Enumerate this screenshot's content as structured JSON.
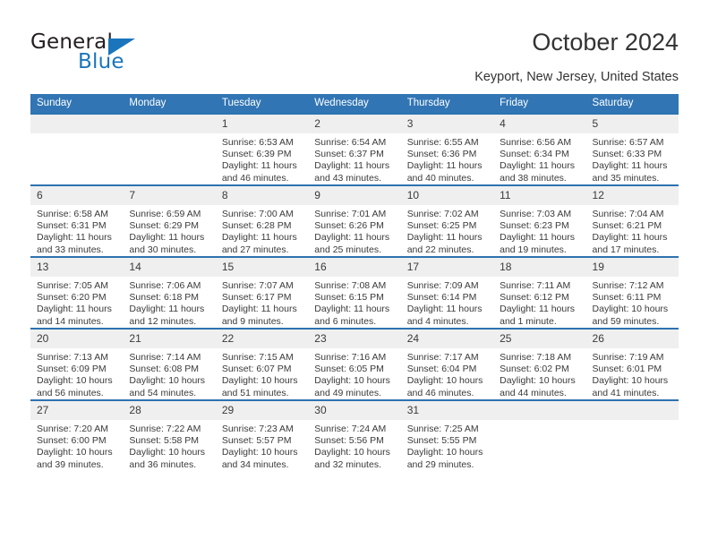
{
  "logo": {
    "word_top": "General",
    "word_bottom": "Blue",
    "accent_color": "#1b75bc"
  },
  "header": {
    "title": "October 2024",
    "subtitle": "Keyport, New Jersey, United States"
  },
  "theme": {
    "header_blue": "#3175b4",
    "row_divider_blue": "#2d72b0",
    "daynum_band": "#efefef"
  },
  "weekday_headers": [
    "Sunday",
    "Monday",
    "Tuesday",
    "Wednesday",
    "Thursday",
    "Friday",
    "Saturday"
  ],
  "labels": {
    "sunrise_prefix": "Sunrise:",
    "sunset_prefix": "Sunset:",
    "daylight_prefix": "Daylight:"
  },
  "weeks": [
    [
      {
        "day": "",
        "sunrise": "",
        "sunset": "",
        "daylight_line1": "",
        "daylight_line2": ""
      },
      {
        "day": "",
        "sunrise": "",
        "sunset": "",
        "daylight_line1": "",
        "daylight_line2": ""
      },
      {
        "day": "1",
        "sunrise": "Sunrise: 6:53 AM",
        "sunset": "Sunset: 6:39 PM",
        "daylight_line1": "Daylight: 11 hours",
        "daylight_line2": "and 46 minutes."
      },
      {
        "day": "2",
        "sunrise": "Sunrise: 6:54 AM",
        "sunset": "Sunset: 6:37 PM",
        "daylight_line1": "Daylight: 11 hours",
        "daylight_line2": "and 43 minutes."
      },
      {
        "day": "3",
        "sunrise": "Sunrise: 6:55 AM",
        "sunset": "Sunset: 6:36 PM",
        "daylight_line1": "Daylight: 11 hours",
        "daylight_line2": "and 40 minutes."
      },
      {
        "day": "4",
        "sunrise": "Sunrise: 6:56 AM",
        "sunset": "Sunset: 6:34 PM",
        "daylight_line1": "Daylight: 11 hours",
        "daylight_line2": "and 38 minutes."
      },
      {
        "day": "5",
        "sunrise": "Sunrise: 6:57 AM",
        "sunset": "Sunset: 6:33 PM",
        "daylight_line1": "Daylight: 11 hours",
        "daylight_line2": "and 35 minutes."
      }
    ],
    [
      {
        "day": "6",
        "sunrise": "Sunrise: 6:58 AM",
        "sunset": "Sunset: 6:31 PM",
        "daylight_line1": "Daylight: 11 hours",
        "daylight_line2": "and 33 minutes."
      },
      {
        "day": "7",
        "sunrise": "Sunrise: 6:59 AM",
        "sunset": "Sunset: 6:29 PM",
        "daylight_line1": "Daylight: 11 hours",
        "daylight_line2": "and 30 minutes."
      },
      {
        "day": "8",
        "sunrise": "Sunrise: 7:00 AM",
        "sunset": "Sunset: 6:28 PM",
        "daylight_line1": "Daylight: 11 hours",
        "daylight_line2": "and 27 minutes."
      },
      {
        "day": "9",
        "sunrise": "Sunrise: 7:01 AM",
        "sunset": "Sunset: 6:26 PM",
        "daylight_line1": "Daylight: 11 hours",
        "daylight_line2": "and 25 minutes."
      },
      {
        "day": "10",
        "sunrise": "Sunrise: 7:02 AM",
        "sunset": "Sunset: 6:25 PM",
        "daylight_line1": "Daylight: 11 hours",
        "daylight_line2": "and 22 minutes."
      },
      {
        "day": "11",
        "sunrise": "Sunrise: 7:03 AM",
        "sunset": "Sunset: 6:23 PM",
        "daylight_line1": "Daylight: 11 hours",
        "daylight_line2": "and 19 minutes."
      },
      {
        "day": "12",
        "sunrise": "Sunrise: 7:04 AM",
        "sunset": "Sunset: 6:21 PM",
        "daylight_line1": "Daylight: 11 hours",
        "daylight_line2": "and 17 minutes."
      }
    ],
    [
      {
        "day": "13",
        "sunrise": "Sunrise: 7:05 AM",
        "sunset": "Sunset: 6:20 PM",
        "daylight_line1": "Daylight: 11 hours",
        "daylight_line2": "and 14 minutes."
      },
      {
        "day": "14",
        "sunrise": "Sunrise: 7:06 AM",
        "sunset": "Sunset: 6:18 PM",
        "daylight_line1": "Daylight: 11 hours",
        "daylight_line2": "and 12 minutes."
      },
      {
        "day": "15",
        "sunrise": "Sunrise: 7:07 AM",
        "sunset": "Sunset: 6:17 PM",
        "daylight_line1": "Daylight: 11 hours",
        "daylight_line2": "and 9 minutes."
      },
      {
        "day": "16",
        "sunrise": "Sunrise: 7:08 AM",
        "sunset": "Sunset: 6:15 PM",
        "daylight_line1": "Daylight: 11 hours",
        "daylight_line2": "and 6 minutes."
      },
      {
        "day": "17",
        "sunrise": "Sunrise: 7:09 AM",
        "sunset": "Sunset: 6:14 PM",
        "daylight_line1": "Daylight: 11 hours",
        "daylight_line2": "and 4 minutes."
      },
      {
        "day": "18",
        "sunrise": "Sunrise: 7:11 AM",
        "sunset": "Sunset: 6:12 PM",
        "daylight_line1": "Daylight: 11 hours",
        "daylight_line2": "and 1 minute."
      },
      {
        "day": "19",
        "sunrise": "Sunrise: 7:12 AM",
        "sunset": "Sunset: 6:11 PM",
        "daylight_line1": "Daylight: 10 hours",
        "daylight_line2": "and 59 minutes."
      }
    ],
    [
      {
        "day": "20",
        "sunrise": "Sunrise: 7:13 AM",
        "sunset": "Sunset: 6:09 PM",
        "daylight_line1": "Daylight: 10 hours",
        "daylight_line2": "and 56 minutes."
      },
      {
        "day": "21",
        "sunrise": "Sunrise: 7:14 AM",
        "sunset": "Sunset: 6:08 PM",
        "daylight_line1": "Daylight: 10 hours",
        "daylight_line2": "and 54 minutes."
      },
      {
        "day": "22",
        "sunrise": "Sunrise: 7:15 AM",
        "sunset": "Sunset: 6:07 PM",
        "daylight_line1": "Daylight: 10 hours",
        "daylight_line2": "and 51 minutes."
      },
      {
        "day": "23",
        "sunrise": "Sunrise: 7:16 AM",
        "sunset": "Sunset: 6:05 PM",
        "daylight_line1": "Daylight: 10 hours",
        "daylight_line2": "and 49 minutes."
      },
      {
        "day": "24",
        "sunrise": "Sunrise: 7:17 AM",
        "sunset": "Sunset: 6:04 PM",
        "daylight_line1": "Daylight: 10 hours",
        "daylight_line2": "and 46 minutes."
      },
      {
        "day": "25",
        "sunrise": "Sunrise: 7:18 AM",
        "sunset": "Sunset: 6:02 PM",
        "daylight_line1": "Daylight: 10 hours",
        "daylight_line2": "and 44 minutes."
      },
      {
        "day": "26",
        "sunrise": "Sunrise: 7:19 AM",
        "sunset": "Sunset: 6:01 PM",
        "daylight_line1": "Daylight: 10 hours",
        "daylight_line2": "and 41 minutes."
      }
    ],
    [
      {
        "day": "27",
        "sunrise": "Sunrise: 7:20 AM",
        "sunset": "Sunset: 6:00 PM",
        "daylight_line1": "Daylight: 10 hours",
        "daylight_line2": "and 39 minutes."
      },
      {
        "day": "28",
        "sunrise": "Sunrise: 7:22 AM",
        "sunset": "Sunset: 5:58 PM",
        "daylight_line1": "Daylight: 10 hours",
        "daylight_line2": "and 36 minutes."
      },
      {
        "day": "29",
        "sunrise": "Sunrise: 7:23 AM",
        "sunset": "Sunset: 5:57 PM",
        "daylight_line1": "Daylight: 10 hours",
        "daylight_line2": "and 34 minutes."
      },
      {
        "day": "30",
        "sunrise": "Sunrise: 7:24 AM",
        "sunset": "Sunset: 5:56 PM",
        "daylight_line1": "Daylight: 10 hours",
        "daylight_line2": "and 32 minutes."
      },
      {
        "day": "31",
        "sunrise": "Sunrise: 7:25 AM",
        "sunset": "Sunset: 5:55 PM",
        "daylight_line1": "Daylight: 10 hours",
        "daylight_line2": "and 29 minutes."
      },
      {
        "day": "",
        "sunrise": "",
        "sunset": "",
        "daylight_line1": "",
        "daylight_line2": ""
      },
      {
        "day": "",
        "sunrise": "",
        "sunset": "",
        "daylight_line1": "",
        "daylight_line2": ""
      }
    ]
  ]
}
